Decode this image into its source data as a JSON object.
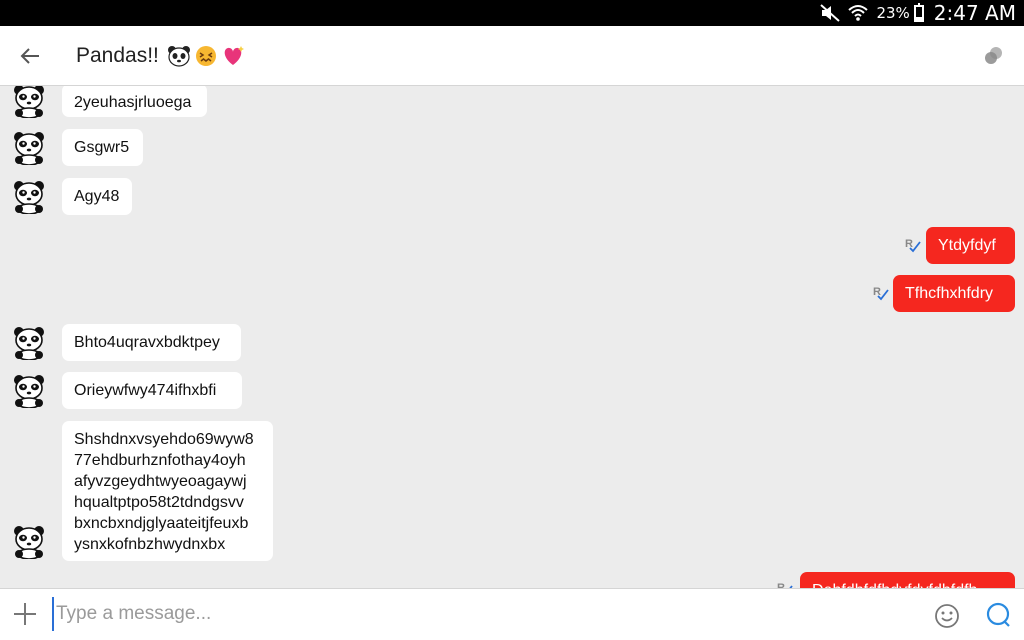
{
  "status_bar": {
    "battery_percent": "23%",
    "battery_level": 0.23,
    "time": "2:47 AM",
    "icons": [
      "mute-icon",
      "wifi-icon",
      "battery-icon"
    ]
  },
  "header": {
    "title": "Pandas!!",
    "title_emojis": [
      "panda-face-emoji",
      "confounded-face-emoji",
      "sparkling-heart-emoji"
    ],
    "back_icon": "back-arrow-icon",
    "menu_icon": "overflow-menu-icon"
  },
  "messages": [
    {
      "direction": "incoming",
      "text": "2yeuhasjrluoega"
    },
    {
      "direction": "incoming",
      "text": "Gsgwr5"
    },
    {
      "direction": "incoming",
      "text": "Agy48"
    },
    {
      "direction": "outgoing",
      "text": "Ytdyfdyf",
      "receipt": "read"
    },
    {
      "direction": "outgoing",
      "text": "Tfhcfhxhfdry",
      "receipt": "read"
    },
    {
      "direction": "incoming",
      "text": "Bhto4uqravxbdktpey"
    },
    {
      "direction": "incoming",
      "text": "Orieywfwy474ifhxbfi"
    },
    {
      "direction": "incoming",
      "text": "Shshdnxvsyehdo69wyw8\n77ehdburhznfothay4oyh\nafyvzgeydhtwyeoagaywj\nhqualtptpo58t2tdndgsvv\nbxncbxndjglyaateitjfeuxb\nysnxkofnbzhwydnxbx"
    },
    {
      "direction": "outgoing",
      "text": "Dehfdhfdfhdyfdyfdhfdfh",
      "receipt": "read"
    }
  ],
  "composer": {
    "placeholder": "Type a message...",
    "value": "",
    "icons": [
      "plus-icon",
      "emoji-icon",
      "send-icon"
    ]
  },
  "colors": {
    "outgoing_bubble": "#f5271f",
    "incoming_bubble": "#ffffff",
    "chat_background": "#ececec",
    "accent": "#2a6fd6"
  }
}
